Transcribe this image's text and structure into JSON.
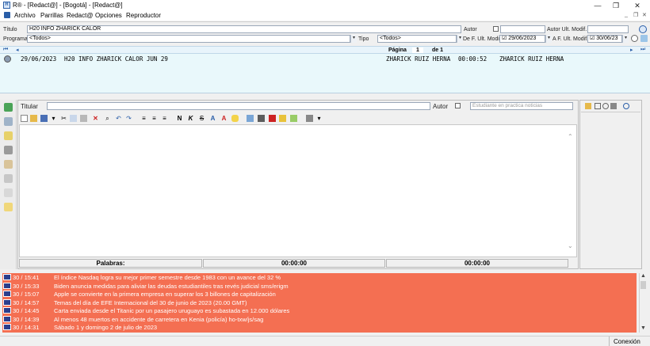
{
  "window": {
    "title": "R® - [Redact@] - [Bogotá] - [Redact@]",
    "minimize": "—",
    "restore": "❐",
    "close": "✕"
  },
  "menu": {
    "items": [
      "Archivo",
      "Parrillas",
      "Redact@",
      "Opciones",
      "Reproductor"
    ],
    "mdi_min": "_",
    "mdi_restore": "❐",
    "mdi_close": "✕"
  },
  "filters": {
    "titulo_label": "Título",
    "titulo_value": "H20 INFO ZHARICK CALOR",
    "autor_label": "Autor",
    "autor_ult_label": "Autor Ult. Modif.",
    "programa_label": "Programa",
    "programa_value": "<Todos>",
    "tipo_label": "Tipo",
    "tipo_value": "<Todos>",
    "de_fecha_label": "De F. Ult. Modif.",
    "de_fecha_value": "29/06/2023",
    "a_fecha_label": "A F. Ult. Modif.",
    "a_fecha_value": "30/06/23",
    "check_mark": "☑"
  },
  "pagination": {
    "first": "⏮",
    "prev": "◂",
    "next": "▸",
    "last": "⏭",
    "pagina_label": "Página",
    "page": "1",
    "of_label": "de 1"
  },
  "results": [
    {
      "date": "29/06/2023",
      "title": "H20 INFO ZHARICK CALOR JUN 29",
      "author": "ZHARICK RUIZ HERNA",
      "duration": "00:00:52",
      "last_author": "ZHARICK RUIZ HERNA"
    }
  ],
  "editor": {
    "titular_label": "Titular",
    "autor_label": "Autor",
    "autor_placeholder": "Estudiante en practica noticias",
    "bold": "N",
    "italic": "K",
    "strike": "S",
    "palabras_label": "Palabras:",
    "time1": "00:00:00",
    "time2": "00:00:00"
  },
  "news": [
    {
      "time": "30 / 15:41",
      "text": "El índice Nasdaq logra su mejor primer semestre desde 1983 con un avance del 32 %"
    },
    {
      "time": "30 / 15:33",
      "text": "Biden anuncia medidas para aliviar las deudas estudiantiles tras revés judicial sms/erigm"
    },
    {
      "time": "30 / 15:07",
      "text": "Apple se convierte en la primera empresa en superar los 3 billones de capitalización"
    },
    {
      "time": "30 / 14:57",
      "text": "Temas del día de EFE Internacional del 30 de junio de 2023 (20.00 GMT)"
    },
    {
      "time": "30 / 14:45",
      "text": "Carta enviada desde el Titanic por un pasajero uruguayo es subastada en 12.000 dólares"
    },
    {
      "time": "30 / 14:39",
      "text": "Al menos 48 muertos en accidente de carretera en Kenia (policía) ho-txw/js/sag"
    },
    {
      "time": "30 / 14:31",
      "text": "Sábado 1 y domingo 2 de julio de 2023"
    }
  ],
  "status": {
    "conexion": "Conexión"
  },
  "colors": {
    "news_bg": "#f46f52",
    "list_bg": "#e9f8fb",
    "accent": "#2a5ea8"
  }
}
